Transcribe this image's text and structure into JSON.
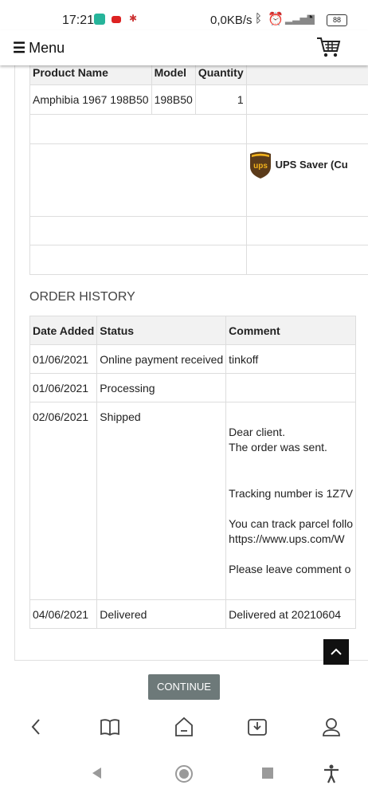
{
  "status_bar": {
    "time": "17:21",
    "net_speed": "0,0KB/s",
    "battery": "88"
  },
  "header": {
    "menu_label": "Menu"
  },
  "products_table": {
    "headers": [
      "Product Name",
      "Model",
      "Quantity"
    ],
    "rows": [
      {
        "name": "Amphibia 1967 198B50",
        "model": "198B50",
        "quantity": "1"
      }
    ],
    "shipping_method": "UPS Saver (Cu"
  },
  "order_history": {
    "title": "ORDER HISTORY",
    "headers": [
      "Date Added",
      "Status",
      "Comment"
    ],
    "rows": [
      {
        "date": "01/06/2021",
        "status": "Online payment received",
        "comment": "tinkoff"
      },
      {
        "date": "01/06/2021",
        "status": "Processing",
        "comment": ""
      },
      {
        "date": "02/06/2021",
        "status": "Shipped",
        "comment_lines": [
          "Dear client.",
          "The order was sent.",
          "Tracking number is 1Z7V",
          "You can track parcel follo",
          "https://www.ups.com/W",
          "Please leave comment o"
        ]
      },
      {
        "date": "04/06/2021",
        "status": "Delivered",
        "comment": "Delivered at 20210604"
      }
    ]
  },
  "continue_label": "CONTINUE",
  "colors": {
    "continue_bg": "#6d7979",
    "table_header_bg": "#f2f2f2",
    "ups_brown": "#5b3b1a",
    "ups_gold": "#f2b21b"
  },
  "icons": [
    "menu-icon",
    "cart-icon",
    "ups-logo",
    "back-to-top-icon",
    "back-icon",
    "book-icon",
    "home-icon",
    "download-icon",
    "profile-icon",
    "sys-back-icon",
    "sys-home-icon",
    "sys-recents-icon",
    "accessibility-icon"
  ]
}
